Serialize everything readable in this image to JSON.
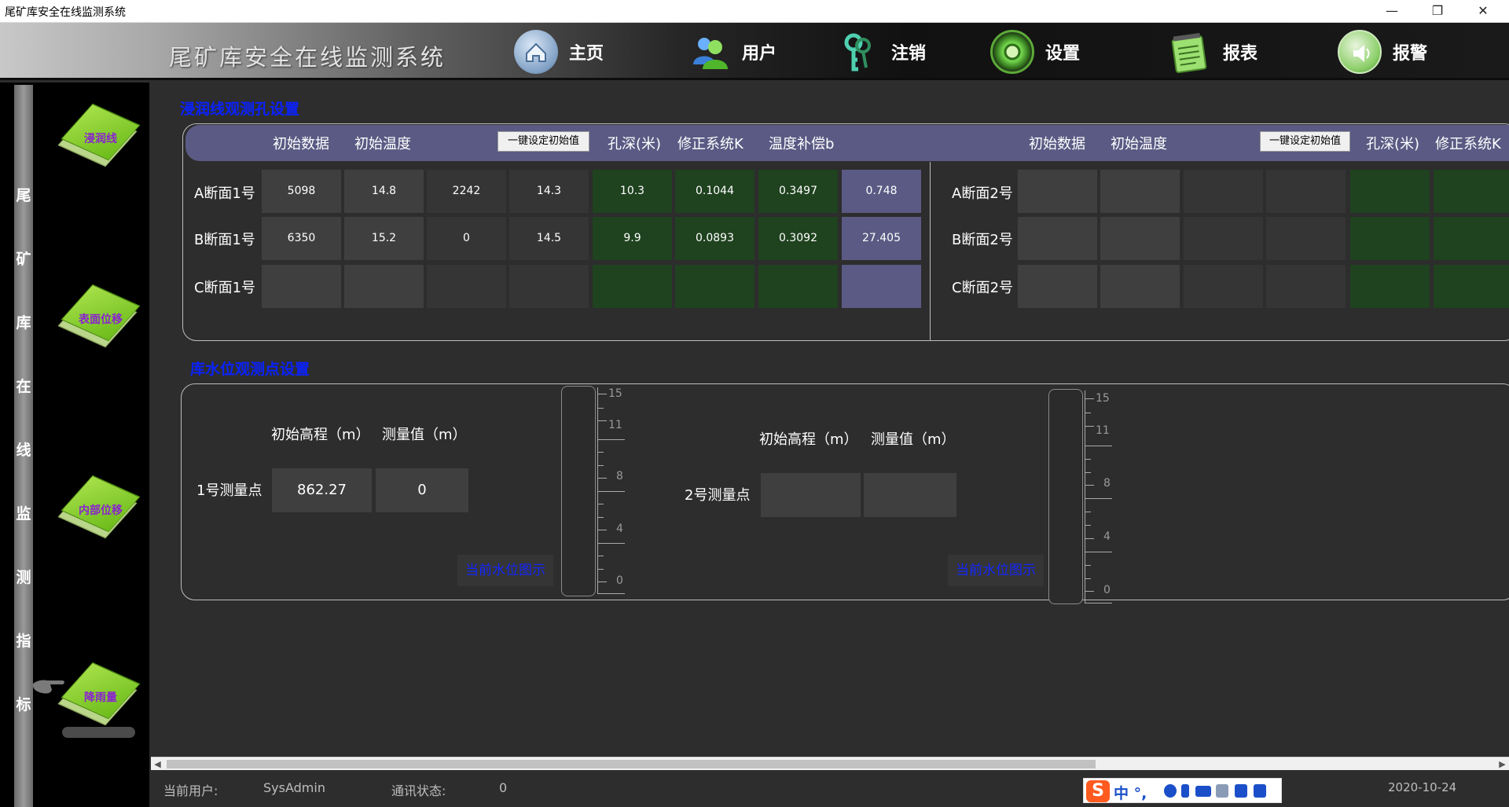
{
  "window": {
    "title": "尾矿库安全在线监测系统"
  },
  "header": {
    "app_title": "尾矿库安全在线监测系统",
    "nav": [
      {
        "label": "主页",
        "icon": "home-icon"
      },
      {
        "label": "用户",
        "icon": "users-icon"
      },
      {
        "label": "注销",
        "icon": "keys-icon"
      },
      {
        "label": "设置",
        "icon": "settings-gear-icon"
      },
      {
        "label": "报表",
        "icon": "notepad-icon"
      },
      {
        "label": "报警",
        "icon": "speaker-icon"
      }
    ]
  },
  "sidebar": {
    "vertical_title": [
      "尾",
      "矿",
      "库",
      "在",
      "线",
      "监",
      "测",
      "指",
      "标"
    ],
    "items": [
      {
        "label": "浸润线"
      },
      {
        "label": "表面位移"
      },
      {
        "label": "内部位移"
      },
      {
        "label": "降雨量"
      }
    ]
  },
  "seepage": {
    "title": "浸润线观测孔设置",
    "headers_left": [
      "初始数据",
      "初始温度",
      "一键设定初始值",
      "孔深(米)",
      "修正系统K",
      "温度补偿b"
    ],
    "headers_right": [
      "初始数据",
      "初始温度",
      "一键设定初始值",
      "孔深(米)",
      "修正系统K"
    ],
    "rows_left": [
      {
        "label": "A断面1号",
        "values": [
          "5098",
          "14.8",
          "2242",
          "14.3",
          "10.3",
          "0.1044",
          "0.3497",
          "0.748"
        ]
      },
      {
        "label": "B断面1号",
        "values": [
          "6350",
          "15.2",
          "0",
          "14.5",
          "9.9",
          "0.0893",
          "0.3092",
          "27.405"
        ]
      },
      {
        "label": "C断面1号",
        "values": [
          "",
          "",
          "",
          "",
          "",
          "",
          "",
          ""
        ]
      }
    ],
    "rows_right": [
      {
        "label": "A断面2号"
      },
      {
        "label": "B断面2号"
      },
      {
        "label": "C断面2号"
      }
    ]
  },
  "water_level": {
    "title": "库水位观测点设置",
    "col_elev": "初始高程（m）",
    "col_meas": "测量值（m）",
    "points": [
      {
        "label": "1号测量点",
        "elev": "862.27",
        "meas": "0",
        "link": "当前水位图示"
      },
      {
        "label": "2号测量点",
        "elev": "",
        "meas": "",
        "link": "当前水位图示"
      }
    ],
    "scale_labels": [
      "15",
      "11",
      "8",
      "4",
      "0"
    ]
  },
  "status": {
    "user_label": "当前用户:",
    "user_value": "SysAdmin",
    "comm_label": "通讯状态:",
    "comm_value": "0",
    "date": "2020-10-24"
  },
  "ime": {
    "logo": "S",
    "mode": "中 °,"
  },
  "colors": {
    "accent_blue": "#0a22ff",
    "header_band": "#5a5a84",
    "green_cell": "#1f421f"
  }
}
